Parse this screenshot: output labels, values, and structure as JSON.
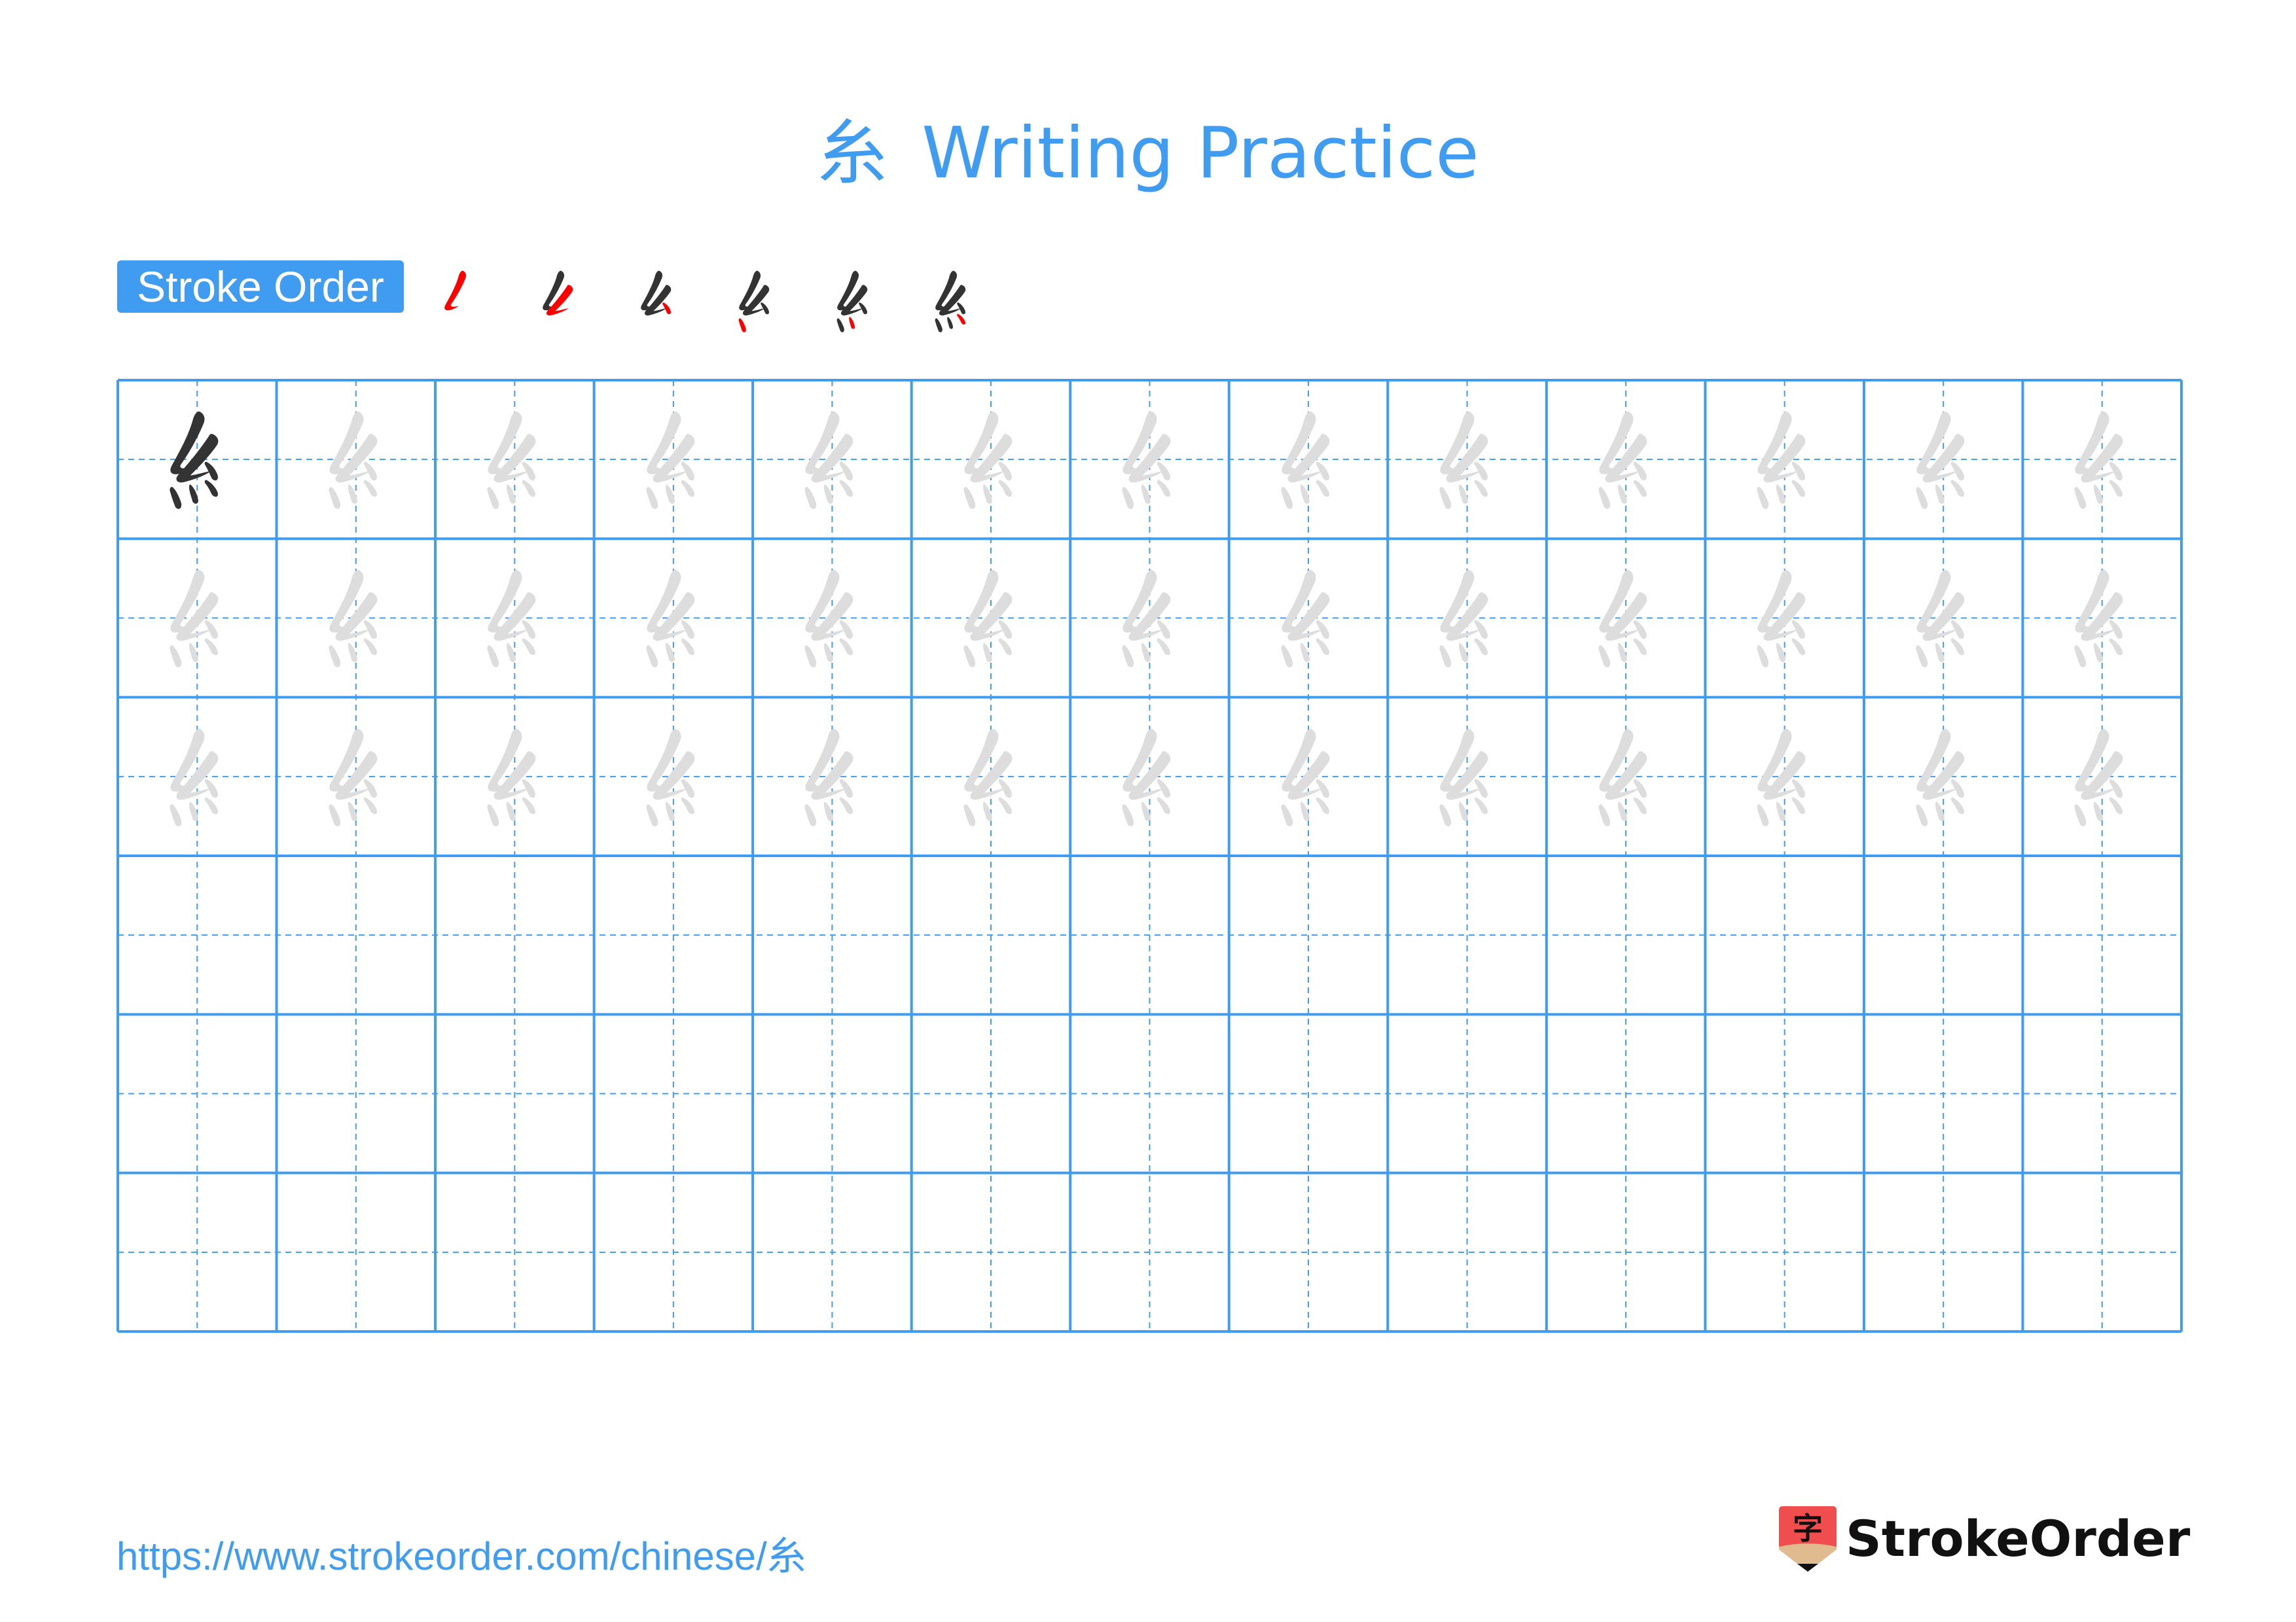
{
  "header": {
    "character": "糸",
    "title_suffix": "Writing Practice"
  },
  "stroke_order": {
    "label": "Stroke Order",
    "total_strokes": 6,
    "highlight_color": "#ff0000",
    "done_color": "#333333"
  },
  "worksheet": {
    "columns": 13,
    "rows": 6,
    "model_rows": 3,
    "empty_rows": 3,
    "first_cell_style": "solid",
    "trace_color": "#dddddd",
    "solid_color": "#333333",
    "grid_color": "#3f9cf0"
  },
  "footer": {
    "url": "https://www.strokeorder.com/chinese/糸",
    "brand": "StrokeOrder",
    "logo_glyph": "字"
  },
  "colors": {
    "accent": "#3f9cf0",
    "logo_red": "#f04e4e",
    "logo_tan": "#dfbb8f"
  }
}
